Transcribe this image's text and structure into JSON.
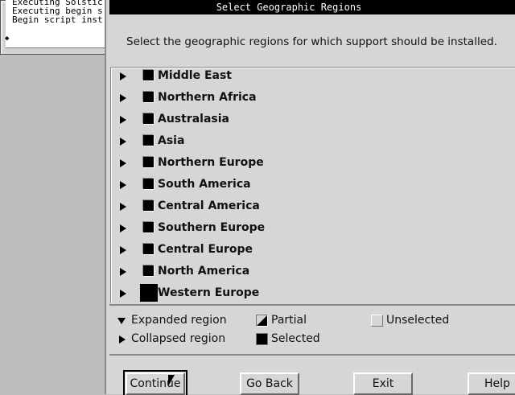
{
  "terminal": {
    "lines": [
      "Executing Solstic",
      "Executing begin s",
      "Begin script inst"
    ]
  },
  "dialog": {
    "title": "Select Geographic Regions",
    "instructions": "Select the geographic regions for which support should be installed."
  },
  "regions": [
    {
      "label": "Middle East",
      "state": "selected"
    },
    {
      "label": "Northern Africa",
      "state": "selected"
    },
    {
      "label": "Australasia",
      "state": "selected"
    },
    {
      "label": "Asia",
      "state": "selected"
    },
    {
      "label": "Northern Europe",
      "state": "selected"
    },
    {
      "label": "South America",
      "state": "selected"
    },
    {
      "label": "Central America",
      "state": "selected"
    },
    {
      "label": "Southern Europe",
      "state": "selected"
    },
    {
      "label": "Central Europe",
      "state": "selected"
    },
    {
      "label": "North America",
      "state": "selected"
    },
    {
      "label": "Western Europe",
      "state": "selected-focused"
    }
  ],
  "legend": {
    "expanded": "Expanded region",
    "collapsed": "Collapsed region",
    "partial": "Partial",
    "selected": "Selected",
    "unselected": "Unselected"
  },
  "buttons": {
    "continue": "Continue",
    "go_back": "Go Back",
    "exit": "Exit",
    "help": "Help"
  }
}
